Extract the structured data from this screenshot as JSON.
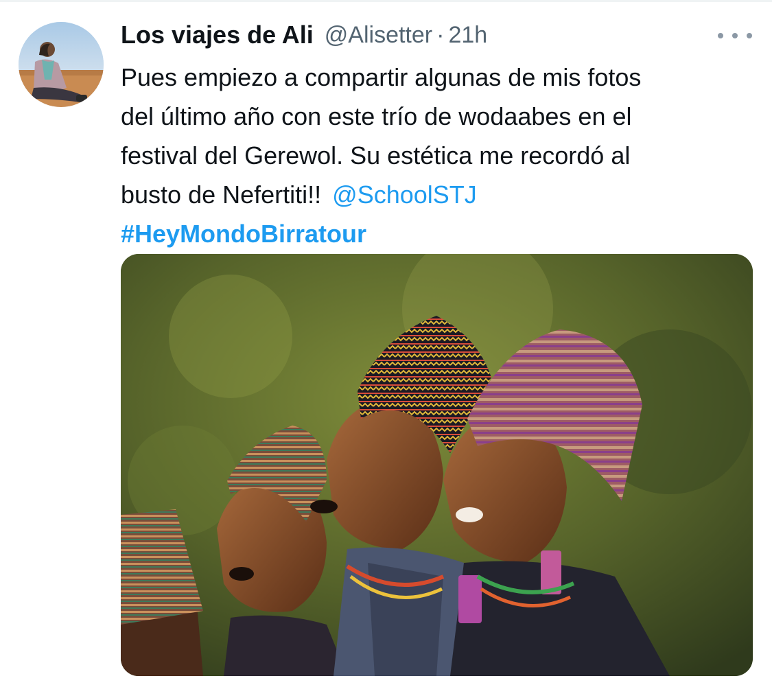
{
  "tweet": {
    "author": {
      "display_name": "Los viajes de Ali",
      "handle": "@Alisetter",
      "avatar_icon": "avatar-photo"
    },
    "separator": "·",
    "timestamp": "21h",
    "more_icon": "ellipsis-icon",
    "text_lines": [
      "Pues empiezo a compartir algunas de mis fotos",
      "del último año con este trío de wodaabes en el",
      "festival del Gerewol. Su estética me recordó al",
      "busto de Nefertiti!!"
    ],
    "mention": "@SchoolSTJ",
    "hashtag": "#HeyMondoBirratour",
    "media_icon": "photo-image"
  },
  "colors": {
    "text": "#0f1419",
    "secondary": "#536471",
    "link": "#1d9bf0"
  }
}
